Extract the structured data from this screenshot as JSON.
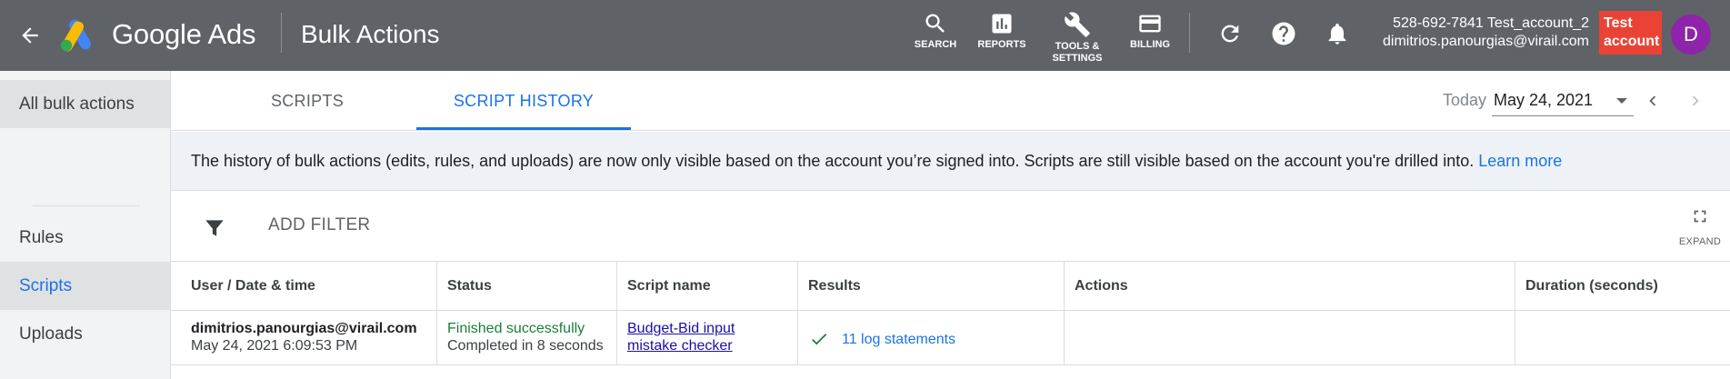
{
  "header": {
    "product_name": "Google Ads",
    "page_title": "Bulk Actions",
    "tools": [
      {
        "label": "SEARCH",
        "icon": "search-icon"
      },
      {
        "label": "REPORTS",
        "icon": "reports-icon"
      },
      {
        "label": "TOOLS &",
        "label2": "SETTINGS",
        "icon": "wrench-icon"
      },
      {
        "label": "BILLING",
        "icon": "credit-card-icon"
      }
    ],
    "account_line1": "528-692-7841 Test_account_2",
    "account_line2": "dimitrios.panourgias@virail.com",
    "badge_line1": "Test",
    "badge_line2": "account",
    "avatar_letter": "D",
    "colors": {
      "bar": "#5f6368",
      "badge": "#ea4335",
      "avatar": "#8e24aa"
    }
  },
  "sidebar": {
    "items": [
      {
        "label": "All bulk actions"
      },
      {
        "label": "Rules"
      },
      {
        "label": "Scripts"
      },
      {
        "label": "Uploads"
      }
    ]
  },
  "tabs": {
    "items": [
      {
        "label": "SCRIPTS"
      },
      {
        "label": "SCRIPT HISTORY"
      }
    ],
    "active": "SCRIPT HISTORY",
    "today_label": "Today",
    "date_value": "May 24, 2021"
  },
  "notice": {
    "text": "The history of bulk actions (edits, rules, and uploads) are now only visible based on the account you’re signed into. Scripts are still visible based on the account you're drilled into.",
    "link": "Learn more"
  },
  "filter": {
    "add_filter_label": "ADD FILTER",
    "expand_label": "EXPAND"
  },
  "table": {
    "columns": [
      "User / Date & time",
      "Status",
      "Script name",
      "Results",
      "Actions",
      "Duration (seconds)"
    ],
    "rows": [
      {
        "user": "dimitrios.panourgias@virail.com",
        "datetime": "May 24, 2021 6:09:53 PM",
        "status": "Finished successfully",
        "status_detail": "Completed in 8 seconds",
        "script_line1": "Budget-Bid input",
        "script_line2": "mistake checker",
        "results": "11 log statements",
        "actions": "",
        "duration": ""
      }
    ]
  }
}
